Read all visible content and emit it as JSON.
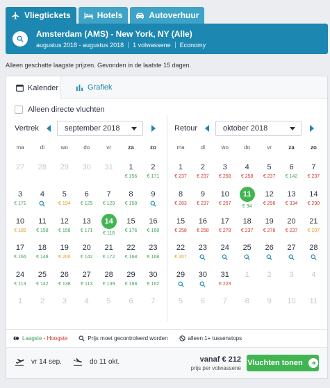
{
  "tabs": [
    {
      "label": "Vliegtickets",
      "icon": "plane-icon",
      "active": true
    },
    {
      "label": "Hotels",
      "icon": "bed-icon",
      "active": false
    },
    {
      "label": "Autoverhuur",
      "icon": "car-icon",
      "active": false
    }
  ],
  "search": {
    "route": "Amsterdam (AMS) - New York, NY (Alle)",
    "dates": "augustus 2018 - augustus 2018",
    "travellers": "1 volwassene",
    "cabin": "Economy"
  },
  "note": "Alleen geschatte laagste prijzen. Gevonden in de laatste 15 dagen.",
  "view_tabs": {
    "calendar": "Kalender",
    "chart": "Grafiek"
  },
  "direct_only": "Alleen directe vluchten",
  "outbound": {
    "label": "Vertrek",
    "month": "september 2018",
    "weekdays": [
      "ma",
      "di",
      "wo",
      "do",
      "vr",
      "za",
      "zo"
    ],
    "rows": [
      [
        {
          "d": "27",
          "o": true
        },
        {
          "d": "28",
          "o": true
        },
        {
          "d": "29",
          "o": true
        },
        {
          "d": "30",
          "o": true
        },
        {
          "d": "31",
          "o": true
        },
        {
          "d": "1",
          "p": "€ 156",
          "c": "green"
        },
        {
          "d": "2",
          "p": "€ 171",
          "c": "green"
        }
      ],
      [
        {
          "d": "3",
          "p": "€ 171",
          "c": "green"
        },
        {
          "d": "4",
          "q": true
        },
        {
          "d": "5",
          "p": "€ 194",
          "c": "orange"
        },
        {
          "d": "6",
          "p": "€ 125",
          "c": "green"
        },
        {
          "d": "7",
          "p": "€ 129",
          "c": "green"
        },
        {
          "d": "8",
          "p": "€ 158",
          "c": "green"
        },
        {
          "d": "9",
          "q": true
        }
      ],
      [
        {
          "d": "10",
          "p": "€ 185",
          "c": "orange"
        },
        {
          "d": "11",
          "p": "€ 158",
          "c": "green"
        },
        {
          "d": "12",
          "p": "€ 158",
          "c": "green"
        },
        {
          "d": "13",
          "p": "€ 171",
          "c": "green"
        },
        {
          "d": "14",
          "p": "€ 118",
          "c": "green",
          "s": true
        },
        {
          "d": "15",
          "p": "€ 176",
          "c": "green"
        },
        {
          "d": "16",
          "p": "€ 168",
          "c": "green"
        }
      ],
      [
        {
          "d": "17",
          "p": "€ 166",
          "c": "green"
        },
        {
          "d": "18",
          "p": "€ 148",
          "c": "green"
        },
        {
          "d": "19",
          "p": "€ 200",
          "c": "orange"
        },
        {
          "d": "20",
          "p": "€ 142",
          "c": "green"
        },
        {
          "d": "21",
          "p": "€ 172",
          "c": "green"
        },
        {
          "d": "22",
          "p": "€ 168",
          "c": "green"
        },
        {
          "d": "23",
          "p": "€ 168",
          "c": "green"
        }
      ],
      [
        {
          "d": "24",
          "p": "€ 113",
          "c": "green"
        },
        {
          "d": "25",
          "p": "€ 142",
          "c": "green"
        },
        {
          "d": "26",
          "p": "€ 138",
          "c": "green"
        },
        {
          "d": "27",
          "p": "€ 113",
          "c": "green"
        },
        {
          "d": "28",
          "p": "€ 139",
          "c": "green"
        },
        {
          "d": "29",
          "p": "€ 168",
          "c": "green"
        },
        {
          "d": "30",
          "p": "€ 162",
          "c": "green"
        }
      ],
      [
        {
          "d": "1",
          "o": true
        },
        {
          "d": "2",
          "o": true
        },
        {
          "d": "3",
          "o": true
        },
        {
          "d": "4",
          "o": true
        },
        {
          "d": "5",
          "o": true
        },
        {
          "d": "6",
          "o": true
        },
        {
          "d": "7",
          "o": true
        }
      ]
    ]
  },
  "return": {
    "label": "Retour",
    "month": "oktober 2018",
    "weekdays": [
      "ma",
      "di",
      "wo",
      "do",
      "vr",
      "za",
      "zo"
    ],
    "rows": [
      [
        {
          "d": "1",
          "p": "€ 237",
          "c": "red"
        },
        {
          "d": "2",
          "p": "€ 237",
          "c": "red"
        },
        {
          "d": "3",
          "p": "€ 258",
          "c": "red"
        },
        {
          "d": "4",
          "p": "€ 258",
          "c": "red"
        },
        {
          "d": "5",
          "p": "€ 237",
          "c": "red"
        },
        {
          "d": "6",
          "p": "€ 142",
          "c": "green"
        },
        {
          "d": "7",
          "p": "€ 237",
          "c": "red"
        }
      ],
      [
        {
          "d": "8",
          "p": "€ 283",
          "c": "red"
        },
        {
          "d": "9",
          "p": "€ 237",
          "c": "red"
        },
        {
          "d": "10",
          "p": "€ 257",
          "c": "red"
        },
        {
          "d": "11",
          "p": "€ 94",
          "c": "green",
          "s": true
        },
        {
          "d": "12",
          "p": "€ 296",
          "c": "red"
        },
        {
          "d": "13",
          "p": "€ 334",
          "c": "red"
        },
        {
          "d": "14",
          "p": "€ 290",
          "c": "red"
        }
      ],
      [
        {
          "d": "15",
          "p": "€ 258",
          "c": "red"
        },
        {
          "d": "16",
          "p": "€ 258",
          "c": "red"
        },
        {
          "d": "17",
          "p": "€ 278",
          "c": "red"
        },
        {
          "d": "18",
          "p": "€ 237",
          "c": "red"
        },
        {
          "d": "19",
          "p": "€ 278",
          "c": "red"
        },
        {
          "d": "20",
          "p": "€ 237",
          "c": "red"
        },
        {
          "d": "21",
          "p": "€ 207",
          "c": "orange"
        }
      ],
      [
        {
          "d": "22",
          "p": "€ 207",
          "c": "orange"
        },
        {
          "d": "23",
          "q": true
        },
        {
          "d": "24",
          "q": true
        },
        {
          "d": "25",
          "q": true
        },
        {
          "d": "26",
          "q": true
        },
        {
          "d": "27",
          "q": true
        },
        {
          "d": "28",
          "q": true
        }
      ],
      [
        {
          "d": "29",
          "q": true
        },
        {
          "d": "30",
          "q": true
        },
        {
          "d": "31",
          "p": "€ 223",
          "c": "red"
        },
        {
          "d": "1",
          "o": true
        },
        {
          "d": "2",
          "o": true
        },
        {
          "d": "3",
          "o": true
        },
        {
          "d": "4",
          "o": true
        }
      ],
      [
        {
          "d": "5",
          "o": true
        },
        {
          "d": "6",
          "o": true
        },
        {
          "d": "7",
          "o": true
        },
        {
          "d": "8",
          "o": true
        },
        {
          "d": "9",
          "o": true
        },
        {
          "d": "10",
          "o": true
        },
        {
          "d": "11",
          "o": true
        }
      ]
    ]
  },
  "legend": {
    "lowest": "Laagste",
    "dash": " - ",
    "highest": "Hoogste",
    "check": "Prijs moet gecontroleerd worden",
    "stops": "alleen 1+ tussenstops"
  },
  "footer": {
    "depart": "vr 14 sep.",
    "ret": "do 11 okt.",
    "price": "vanaf € 212",
    "per": "prijs per volwassene",
    "cta": "Vluchten tonen"
  },
  "colors": {
    "primary": "#1c87b0",
    "green": "#42b553",
    "red": "#d0342c",
    "orange": "#e89a1a"
  }
}
